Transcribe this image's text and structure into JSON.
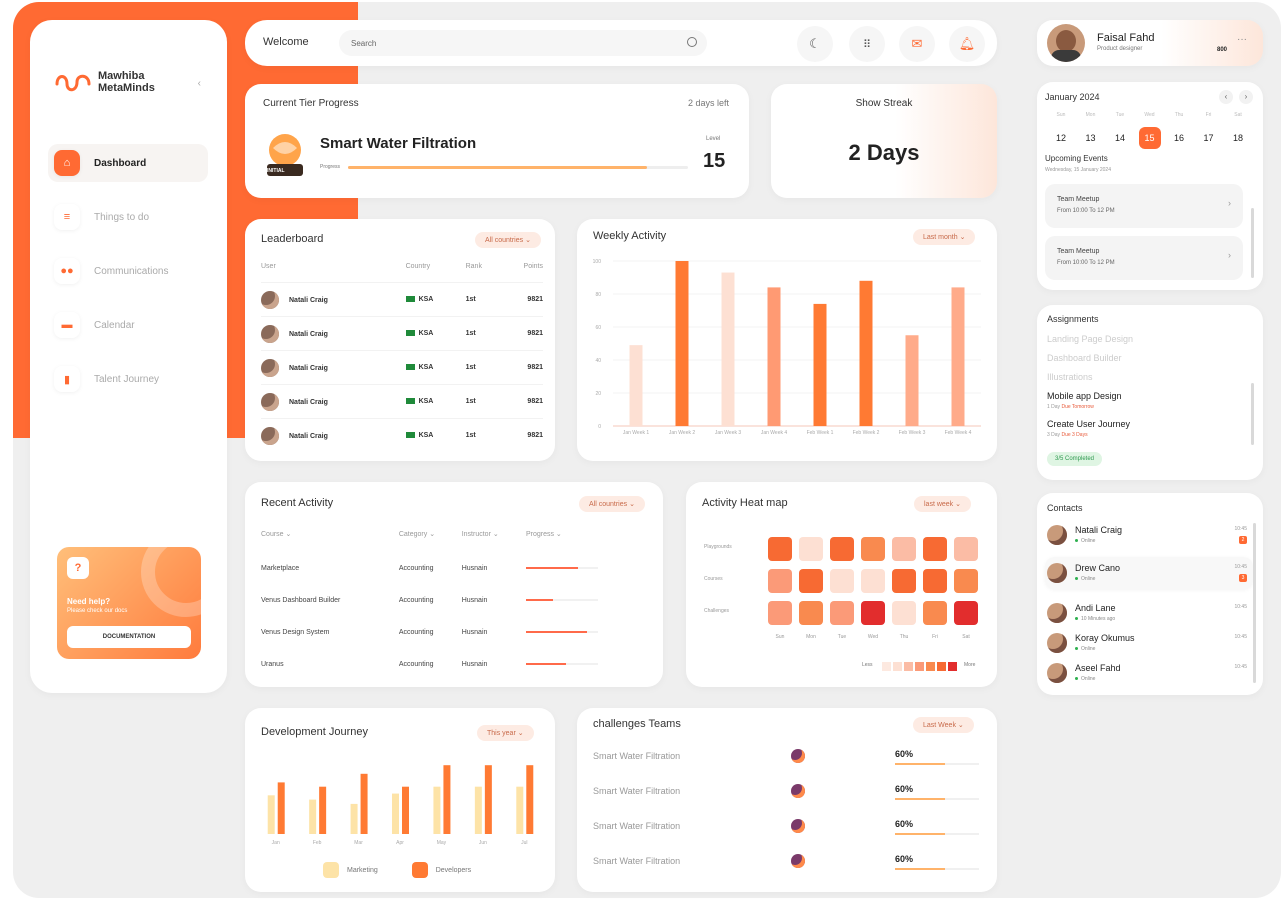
{
  "sidebar": {
    "logo_line1": "Mawhiba",
    "logo_line2": "MetaMinds",
    "items": [
      {
        "label": "Dashboard",
        "icon": "home-icon"
      },
      {
        "label": "Things to do",
        "icon": "checklist-icon"
      },
      {
        "label": "Communications",
        "icon": "people-icon"
      },
      {
        "label": "Calendar",
        "icon": "calendar-icon"
      },
      {
        "label": "Talent Journey",
        "icon": "chart-icon"
      }
    ],
    "help": {
      "title": "Need help?",
      "subtitle": "Please check our docs",
      "button": "DOCUMENTATION"
    }
  },
  "topbar": {
    "welcome": "Welcome",
    "search_placeholder": "Search"
  },
  "tier": {
    "title": "Current Tier Progress",
    "days_left": "2 days left",
    "name": "Smart Water Filtration",
    "progress_label": "Progress",
    "progress": 0.88,
    "level_label": "Level",
    "level": "15",
    "badge_text": "INITIAL"
  },
  "streak": {
    "title": "Show Streak",
    "value": "2 Days"
  },
  "leaderboard": {
    "title": "Leaderboard",
    "filter": "All countries",
    "columns": [
      "User",
      "Country",
      "Rank",
      "Points"
    ],
    "rows": [
      {
        "user": "Natali Craig",
        "country": "KSA",
        "rank": "1st",
        "points": "9821"
      },
      {
        "user": "Natali Craig",
        "country": "KSA",
        "rank": "1st",
        "points": "9821"
      },
      {
        "user": "Natali Craig",
        "country": "KSA",
        "rank": "1st",
        "points": "9821"
      },
      {
        "user": "Natali Craig",
        "country": "KSA",
        "rank": "1st",
        "points": "9821"
      },
      {
        "user": "Natali Craig",
        "country": "KSA",
        "rank": "1st",
        "points": "9821"
      }
    ]
  },
  "weekly": {
    "title": "Weekly Activity",
    "filter": "Last month"
  },
  "recent": {
    "title": "Recent Activity",
    "filter": "All countries",
    "columns": [
      "Course",
      "Category",
      "Instructor",
      "Progress"
    ],
    "rows": [
      {
        "course": "Marketplace",
        "category": "Accounting",
        "instructor": "Husnain",
        "progress": 0.72
      },
      {
        "course": "Venus Dashboard Builder",
        "category": "Accounting",
        "instructor": "Husnain",
        "progress": 0.38
      },
      {
        "course": "Venus Design System",
        "category": "Accounting",
        "instructor": "Husnain",
        "progress": 0.85
      },
      {
        "course": "Uranus",
        "category": "Accounting",
        "instructor": "Husnain",
        "progress": 0.55
      }
    ]
  },
  "heatmap": {
    "title": "Activity Heat map",
    "filter": "last week",
    "rows": [
      "Playgrounds",
      "Courses",
      "Challenges"
    ],
    "days": [
      "Sun",
      "Mon",
      "Tue",
      "Wed",
      "Thu",
      "Fri",
      "Sat"
    ],
    "levels": [
      [
        5,
        1,
        5,
        4,
        2,
        5,
        2
      ],
      [
        3,
        5,
        1,
        1,
        5,
        5,
        4
      ],
      [
        3,
        4,
        3,
        6,
        1,
        4,
        6
      ]
    ],
    "legend_less": "Less",
    "legend_more": "More"
  },
  "dev": {
    "title": "Development Journey",
    "filter": "This year",
    "legend": [
      "Marketing",
      "Developers"
    ]
  },
  "challenges": {
    "title": "challenges Teams",
    "filter": "Last Week",
    "rows": [
      {
        "name": "Smart Water Filtration",
        "pct": "60%",
        "value": 0.6
      },
      {
        "name": "Smart Water Filtration",
        "pct": "60%",
        "value": 0.6
      },
      {
        "name": "Smart Water Filtration",
        "pct": "60%",
        "value": 0.6
      },
      {
        "name": "Smart Water Filtration",
        "pct": "60%",
        "value": 0.6
      }
    ]
  },
  "profile": {
    "name": "Faisal Fahd",
    "role": "Product designer",
    "points": "800"
  },
  "calendar": {
    "month": "January 2024",
    "dow": [
      "Sun",
      "Mon",
      "Tue",
      "Wed",
      "Thu",
      "Fri",
      "Sat"
    ],
    "days": [
      "12",
      "13",
      "14",
      "15",
      "16",
      "17",
      "18"
    ],
    "selected": "15",
    "events_title": "Upcoming Events",
    "events_date": "Wednesday, 15 January 2024",
    "events": [
      {
        "name": "Team Meetup",
        "time": "From 10:00 To 12 PM"
      },
      {
        "name": "Team Meetup",
        "time": "From 10:00 To 12 PM"
      }
    ]
  },
  "assignments": {
    "title": "Assignments",
    "done": [
      "Landing Page Design",
      "Dashboard Builder",
      "Illustrations"
    ],
    "pending": [
      {
        "name": "Mobile app Design",
        "days": "1 Day",
        "status": "Due Tomorrow"
      },
      {
        "name": "Create User Journey",
        "days": "3 Day",
        "status": "Due 3 Days"
      }
    ],
    "completed": "3/5 Completed"
  },
  "contacts": {
    "title": "Contacts",
    "items": [
      {
        "name": "Natali Craig",
        "status": "Online",
        "time": "10:45",
        "badge": "2"
      },
      {
        "name": "Drew Cano",
        "status": "Online",
        "time": "10:45",
        "badge": "3"
      },
      {
        "name": "Andi Lane",
        "status": "10 Minutes ago",
        "time": "10:45",
        "badge": ""
      },
      {
        "name": "Koray Okumus",
        "status": "Online",
        "time": "10:45",
        "badge": ""
      },
      {
        "name": "Aseel Fahd",
        "status": "Online",
        "time": "10:45",
        "badge": ""
      }
    ]
  },
  "chart_data": [
    {
      "type": "bar",
      "title": "Weekly Activity",
      "categories": [
        "Jan Week 1",
        "Jan Week 2",
        "Jan Week 3",
        "Jan Week 4",
        "Feb Week 1",
        "Feb Week 2",
        "Feb Week 3",
        "Feb Week 4"
      ],
      "values": [
        49,
        100,
        93,
        84,
        74,
        88,
        55,
        84
      ],
      "colors": [
        "#fde0d3",
        "#ff7a33",
        "#fde0d3",
        "#ff9a73",
        "#ff7a33",
        "#ff7a33",
        "#ffab8a",
        "#ffab8a"
      ],
      "ylim": [
        0,
        100
      ],
      "yticks": [
        "0",
        "20",
        "40",
        "60",
        "80",
        "100"
      ]
    },
    {
      "type": "bar",
      "title": "Development Journey",
      "categories": [
        "Jan",
        "Feb",
        "Mar",
        "Apr",
        "May",
        "Jun",
        "Jul"
      ],
      "series": [
        {
          "name": "Marketing",
          "values": [
            45,
            40,
            35,
            47,
            55,
            55,
            55
          ],
          "color": "#fde3a7"
        },
        {
          "name": "Developers",
          "values": [
            60,
            55,
            70,
            55,
            80,
            80,
            80
          ],
          "color": "#ff7a33"
        }
      ],
      "ylim": [
        0,
        100
      ]
    }
  ]
}
